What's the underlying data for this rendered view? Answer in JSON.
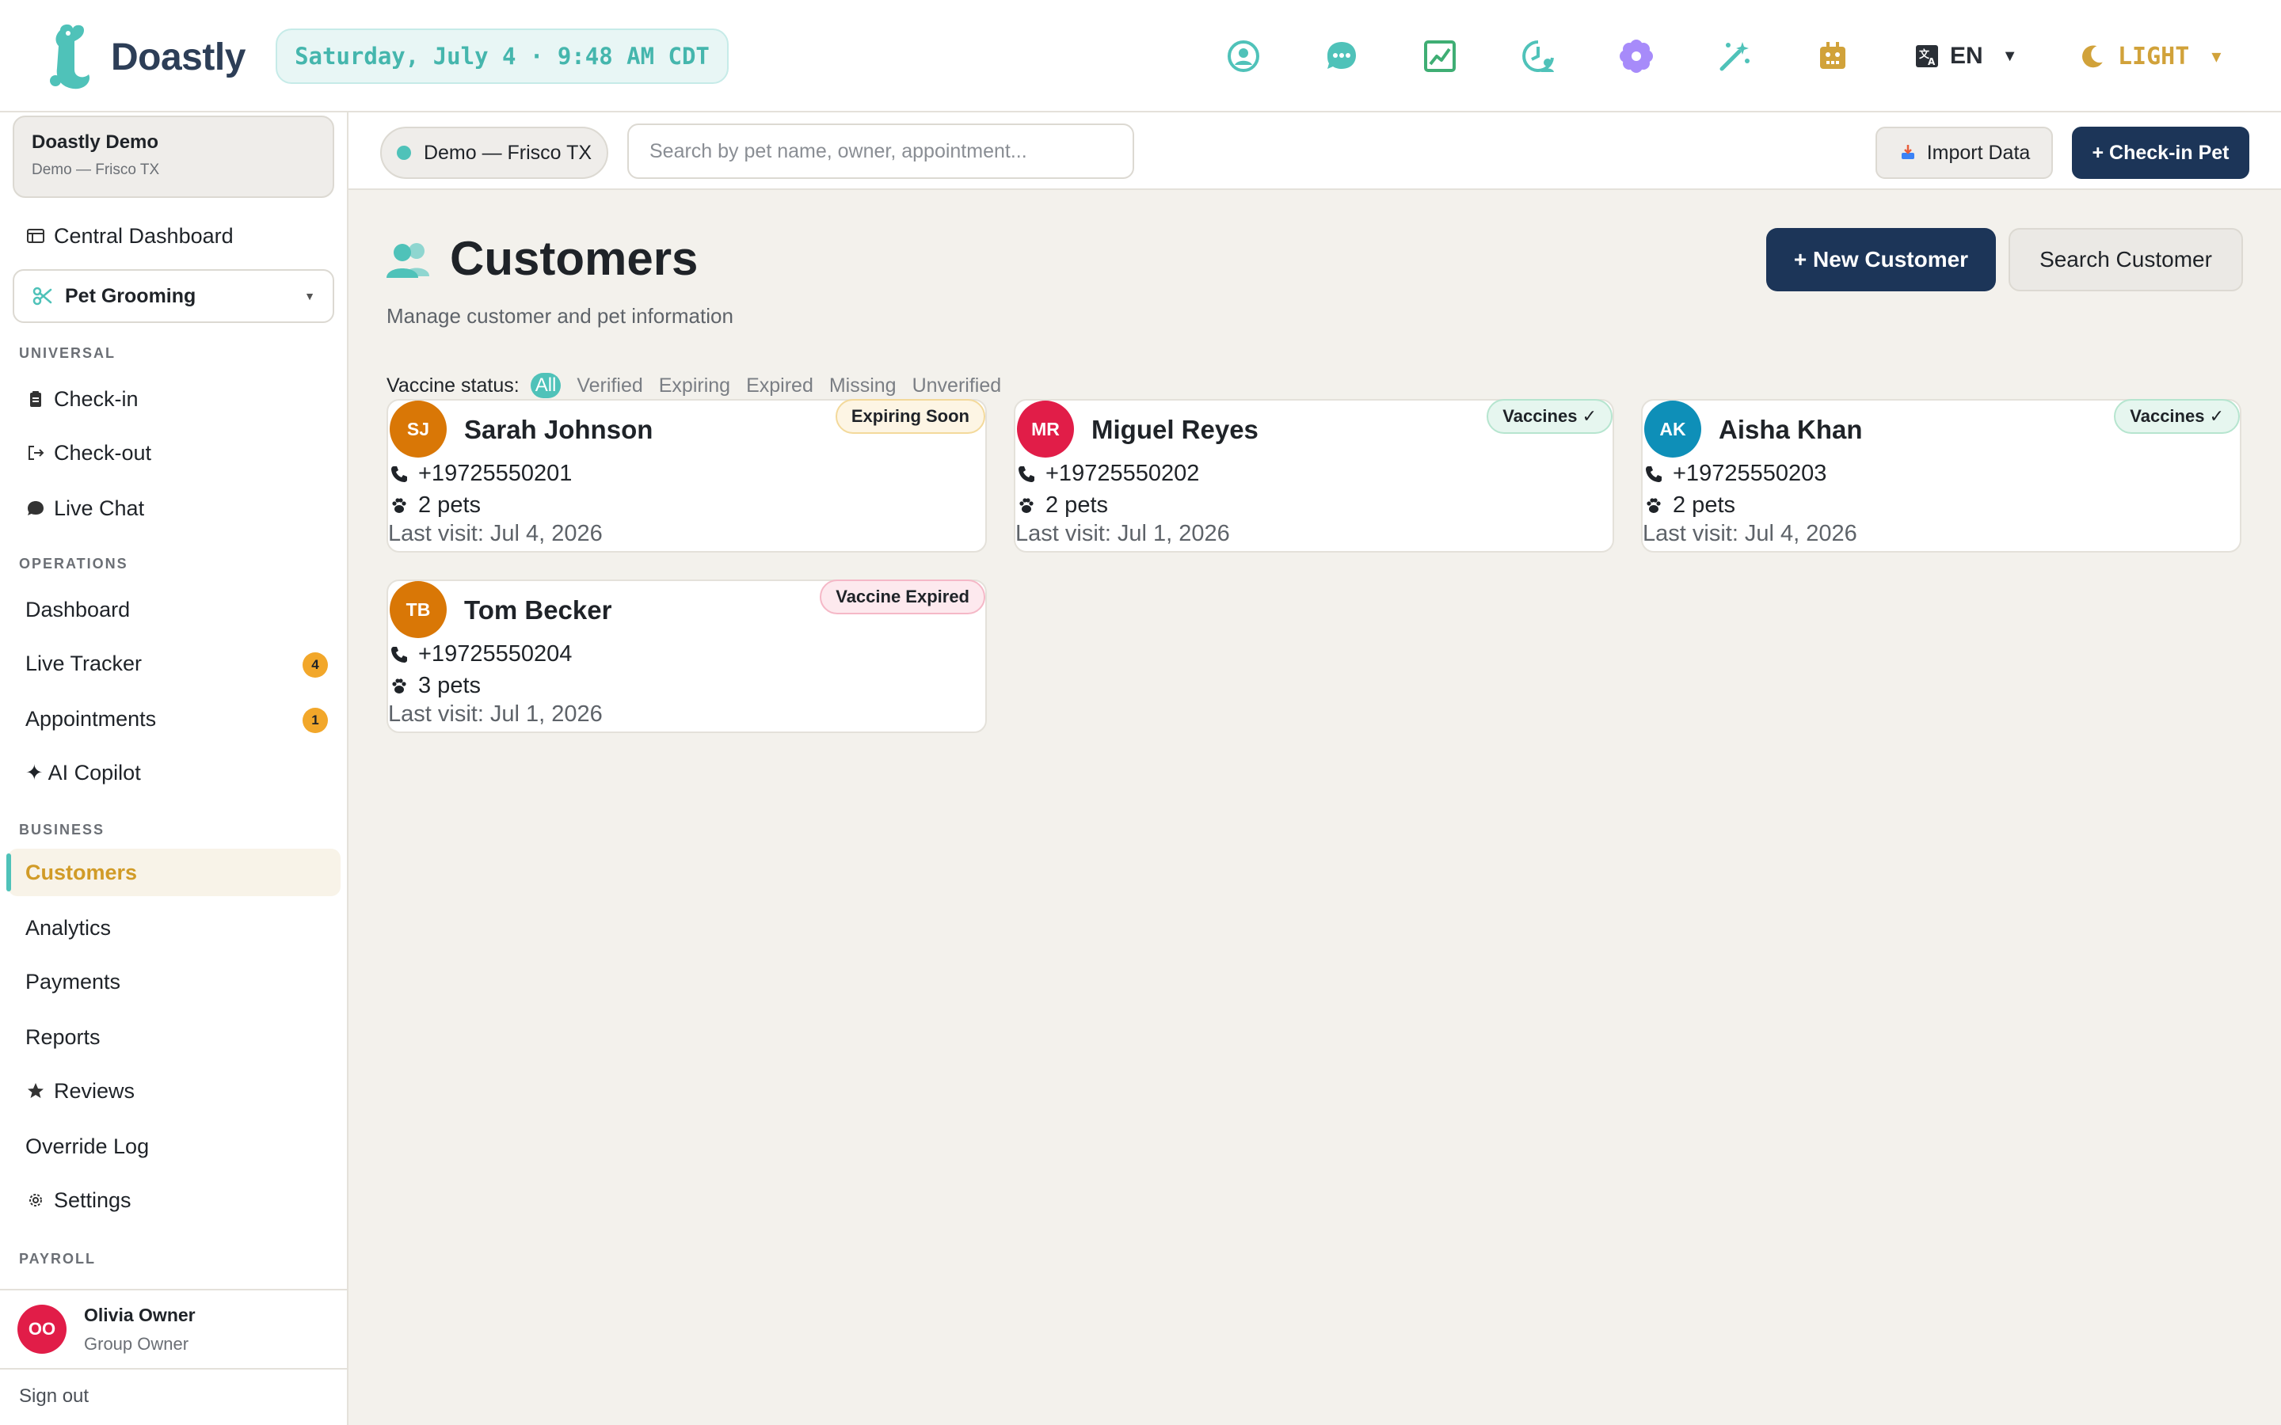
{
  "app": {
    "brand": "Doastly",
    "datetime": "Saturday, July 4 · 9:48 AM CDT",
    "language": "EN",
    "theme": "LIGHT",
    "top_icons": [
      "user-circle-icon",
      "chat-bubble-icon",
      "trend-chart-icon",
      "clock-user-icon",
      "flower-icon",
      "magic-wand-icon",
      "robot-icon"
    ]
  },
  "sidebar": {
    "org_name": "Doastly Demo",
    "org_location": "Demo — Frisco TX",
    "central_dashboard": "Central Dashboard",
    "service": "Pet Grooming",
    "sections": {
      "universal": "UNIVERSAL",
      "operations": "OPERATIONS",
      "business": "BUSINESS",
      "payroll": "PAYROLL"
    },
    "universal_items": [
      "Check-in",
      "Check-out",
      "Live Chat"
    ],
    "operations_items": [
      "Dashboard",
      "Live Tracker",
      "Appointments",
      "✦ AI Copilot"
    ],
    "badges": {
      "live_tracker": "4",
      "appointments": "1"
    },
    "business_items": [
      "Customers",
      "Analytics",
      "Payments",
      "Reports",
      "Reviews",
      "Override Log",
      "Settings"
    ],
    "active_item": "Customers",
    "user": {
      "initials": "OO",
      "name": "Olivia Owner",
      "role": "Group Owner"
    },
    "sign_out": "Sign out"
  },
  "subbar": {
    "location": "Demo — Frisco TX",
    "search_placeholder": "Search by pet name, owner, appointment...",
    "import_label": "Import Data",
    "checkin_label": "+ Check-in Pet"
  },
  "main": {
    "title": "Customers",
    "subtitle": "Manage customer and pet information",
    "new_customer": "+ New Customer",
    "search_customer": "Search Customer",
    "vaccine_label": "Vaccine status:",
    "vaccine_filters": [
      "All",
      "Verified",
      "Expiring",
      "Expired",
      "Missing",
      "Unverified"
    ],
    "active_filter": "All",
    "customers": [
      {
        "initials": "SJ",
        "name": "Sarah Johnson",
        "status": "Expiring Soon",
        "status_type": "warn",
        "phone": "+19725550201",
        "pets": "2 pets",
        "last_visit": "Last visit: Jul 4, 2026",
        "avatar_color": "#d97706"
      },
      {
        "initials": "MR",
        "name": "Miguel Reyes",
        "status": "Vaccines ✓",
        "status_type": "ok",
        "phone": "+19725550202",
        "pets": "2 pets",
        "last_visit": "Last visit: Jul 1, 2026",
        "avatar_color": "#e11d48"
      },
      {
        "initials": "AK",
        "name": "Aisha Khan",
        "status": "Vaccines ✓",
        "status_type": "ok",
        "phone": "+19725550203",
        "pets": "2 pets",
        "last_visit": "Last visit: Jul 4, 2026",
        "avatar_color": "#0e8fb8"
      },
      {
        "initials": "TB",
        "name": "Tom Becker",
        "status": "Vaccine Expired",
        "status_type": "bad",
        "phone": "+19725550204",
        "pets": "3 pets",
        "last_visit": "Last visit: Jul 1, 2026",
        "avatar_color": "#d97706"
      }
    ]
  },
  "colors": {
    "accent_teal": "#4fc2b9",
    "navy": "#1c3558",
    "gold": "#d19b27",
    "badge_orange": "#f2a72a"
  }
}
